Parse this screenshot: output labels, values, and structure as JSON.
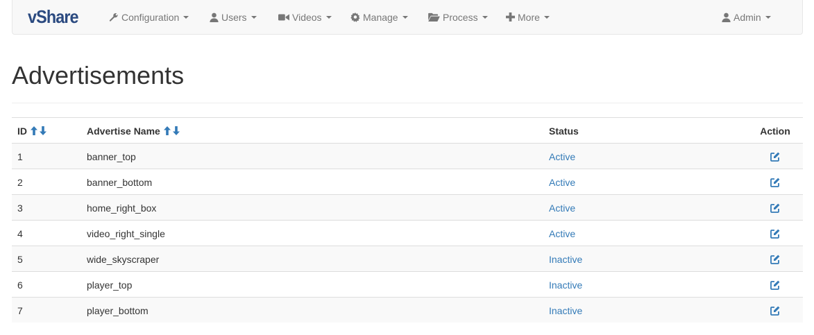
{
  "brand": "vShare",
  "nav": {
    "items": [
      {
        "label": "Configuration",
        "icon": "wrench-icon"
      },
      {
        "label": "Users",
        "icon": "user-icon"
      },
      {
        "label": "Videos",
        "icon": "video-camera-icon"
      },
      {
        "label": "Manage",
        "icon": "gear-icon"
      },
      {
        "label": "Process",
        "icon": "folder-open-icon"
      },
      {
        "label": "More",
        "icon": "plus-icon"
      }
    ],
    "user": {
      "label": "Admin",
      "icon": "user-icon"
    }
  },
  "page": {
    "title": "Advertisements"
  },
  "table": {
    "headers": {
      "id": "ID",
      "name": "Advertise Name",
      "status": "Status",
      "action": "Action"
    },
    "rows": [
      {
        "id": "1",
        "name": "banner_top",
        "status": "Active"
      },
      {
        "id": "2",
        "name": "banner_bottom",
        "status": "Active"
      },
      {
        "id": "3",
        "name": "home_right_box",
        "status": "Active"
      },
      {
        "id": "4",
        "name": "video_right_single",
        "status": "Active"
      },
      {
        "id": "5",
        "name": "wide_skyscraper",
        "status": "Inactive"
      },
      {
        "id": "6",
        "name": "player_top",
        "status": "Inactive"
      },
      {
        "id": "7",
        "name": "player_bottom",
        "status": "Inactive"
      }
    ]
  },
  "colors": {
    "brand": "#2b4a80",
    "link": "#337ab7",
    "nav_text": "#777777",
    "stripe": "#f9f9f9"
  }
}
